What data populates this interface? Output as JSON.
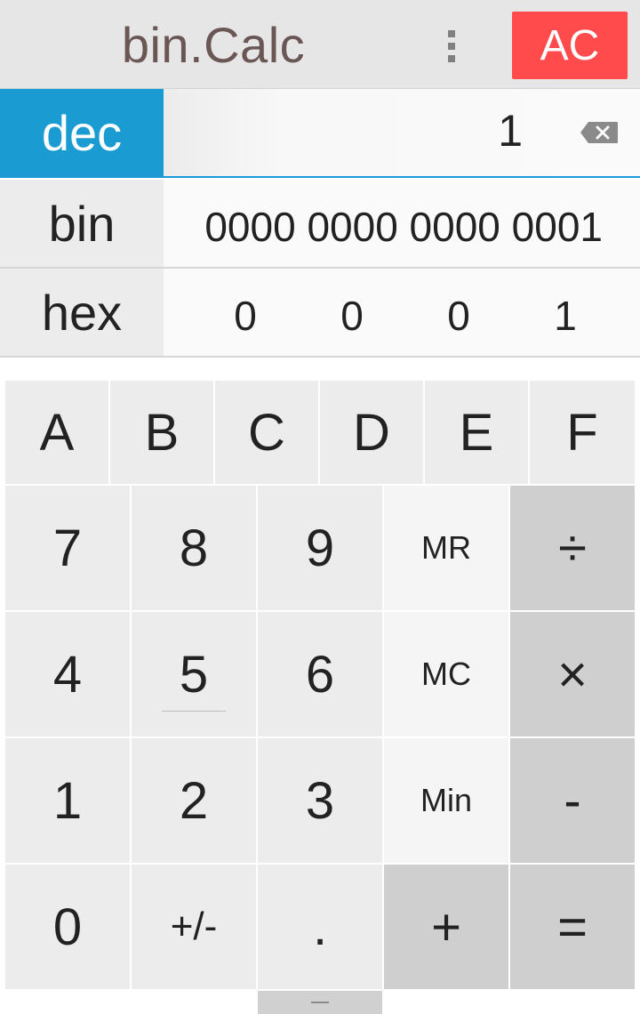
{
  "header": {
    "title": "bin.Calc",
    "menu_icon": "overflow-menu-icon",
    "clear_label": "AC"
  },
  "rows": {
    "dec": {
      "label": "dec",
      "value": "1"
    },
    "bin": {
      "label": "bin",
      "value": "0000 0000 0000 0001"
    },
    "hex": {
      "label": "hex",
      "digits": [
        "0",
        "0",
        "0",
        "1"
      ]
    }
  },
  "keypad": {
    "hex_keys": [
      "A",
      "B",
      "C",
      "D",
      "E",
      "F"
    ],
    "row1": [
      "7",
      "8",
      "9",
      "MR",
      "÷"
    ],
    "row2": [
      "4",
      "5",
      "6",
      "MC",
      "×"
    ],
    "row3": [
      "1",
      "2",
      "3",
      "Min",
      "-"
    ],
    "row4": [
      "0",
      "+/-",
      ".",
      "+",
      "="
    ]
  },
  "colors": {
    "accent": "#1a9bd2",
    "clear": "#ff4b4b",
    "title": "#6b5656"
  }
}
